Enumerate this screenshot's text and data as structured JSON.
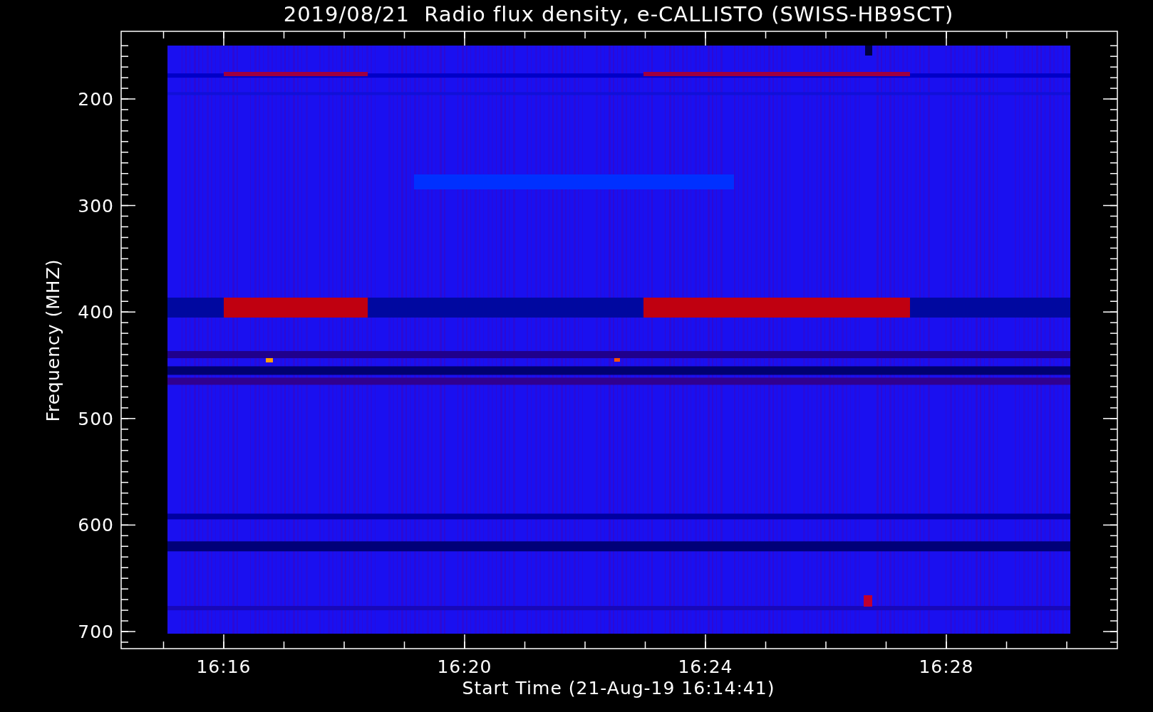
{
  "plot": {
    "title": "2019/08/21  Radio flux density, e-CALLISTO (SWISS-HB9SCT)",
    "ylabel": "Frequency (MHZ)",
    "xlabel": "Start Time (21-Aug-19 16:14:41)",
    "yticks": [
      "200",
      "300",
      "400",
      "500",
      "600",
      "700"
    ],
    "xticks": [
      "16:16",
      "16:20",
      "16:24",
      "16:28"
    ]
  }
}
